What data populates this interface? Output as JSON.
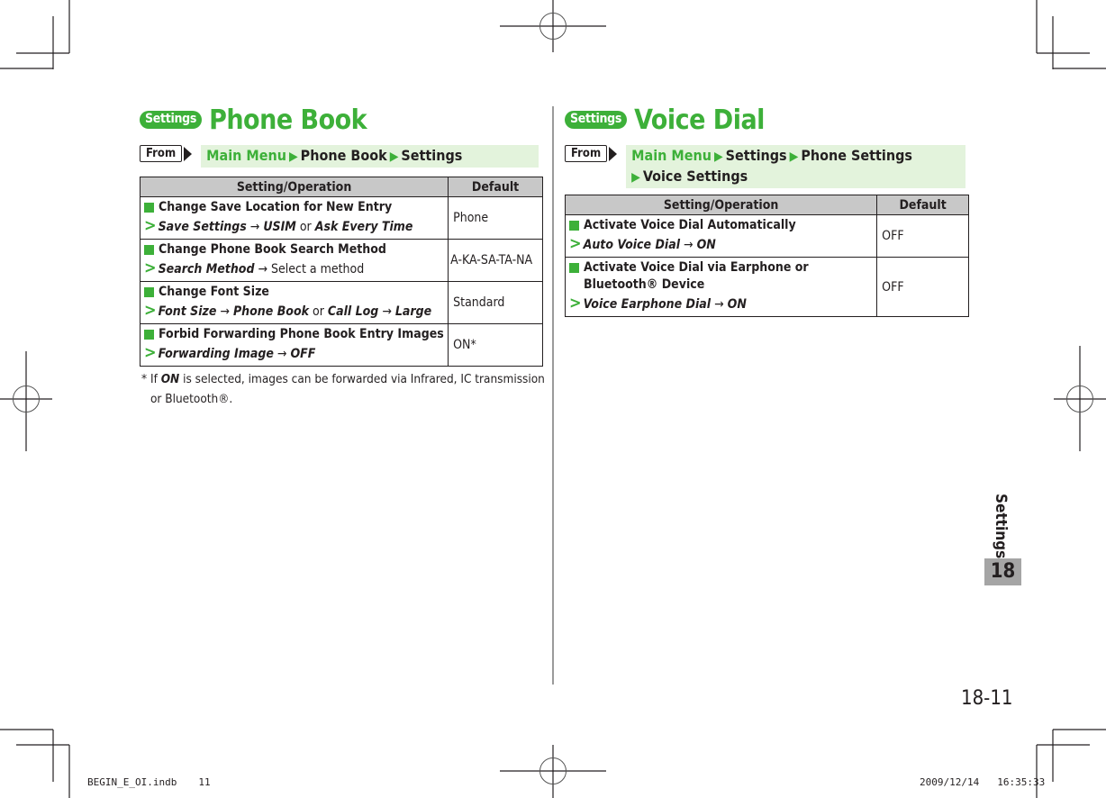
{
  "sections": [
    {
      "badge": "Settings",
      "title": "Phone Book",
      "from_label": "From",
      "path": [
        "Main Menu",
        "Phone Book",
        "Settings"
      ],
      "table": {
        "headers": [
          "Setting/Operation",
          "Default"
        ],
        "rows": [
          {
            "name": "Change Save Location for New Entry",
            "op": [
              {
                "t": "Save Settings",
                "s": "it"
              },
              {
                "t": " → ",
                "s": "n"
              },
              {
                "t": "USIM",
                "s": "it"
              },
              {
                "t": " or ",
                "s": "n"
              },
              {
                "t": "Ask Every Time",
                "s": "it"
              }
            ],
            "default": "Phone"
          },
          {
            "name": "Change Phone Book Search Method",
            "op": [
              {
                "t": "Search Method",
                "s": "it"
              },
              {
                "t": " → Select a method",
                "s": "n"
              }
            ],
            "default": "A-KA-SA-TA-NA"
          },
          {
            "name": "Change Font Size",
            "op": [
              {
                "t": "Font Size",
                "s": "it"
              },
              {
                "t": " → ",
                "s": "n"
              },
              {
                "t": "Phone Book",
                "s": "it"
              },
              {
                "t": " or ",
                "s": "n"
              },
              {
                "t": "Call Log",
                "s": "it"
              },
              {
                "t": " → ",
                "s": "n"
              },
              {
                "t": "Large",
                "s": "it"
              }
            ],
            "default": "Standard"
          },
          {
            "name": "Forbid Forwarding Phone Book Entry Images",
            "op": [
              {
                "t": "Forwarding Image",
                "s": "it"
              },
              {
                "t": " → ",
                "s": "n"
              },
              {
                "t": "OFF",
                "s": "it"
              }
            ],
            "default": "ON*"
          }
        ]
      },
      "footnote": {
        "mark": "*",
        "pre": "If ",
        "em": "ON",
        "post": " is selected, images can be forwarded via Infrared, IC transmission or Bluetooth®."
      }
    },
    {
      "badge": "Settings",
      "title": "Voice Dial",
      "from_label": "From",
      "path": [
        "Main Menu",
        "Settings",
        "Phone Settings",
        "Voice Settings"
      ],
      "table": {
        "headers": [
          "Setting/Operation",
          "Default"
        ],
        "rows": [
          {
            "name": "Activate Voice Dial Automatically",
            "op": [
              {
                "t": "Auto Voice Dial",
                "s": "it"
              },
              {
                "t": " → ",
                "s": "n"
              },
              {
                "t": "ON",
                "s": "it"
              }
            ],
            "default": "OFF"
          },
          {
            "name": "Activate Voice Dial via Earphone or Bluetooth® Device",
            "op": [
              {
                "t": "Voice Earphone Dial",
                "s": "it"
              },
              {
                "t": " → ",
                "s": "n"
              },
              {
                "t": "ON",
                "s": "it"
              }
            ],
            "default": "OFF"
          }
        ]
      }
    }
  ],
  "side_tab": {
    "label": "Settings",
    "chapter": "18"
  },
  "page_number": "18-11",
  "slug": {
    "file": "BEGIN_E_OI.indb",
    "page": "11",
    "date": "2009/12/14",
    "time": "16:35:33"
  },
  "colors": {
    "accent": "#3db039",
    "path_bg": "#e3f3dc",
    "header_bg": "#c8c8c8",
    "chapter_bg": "#a5a5a5"
  }
}
